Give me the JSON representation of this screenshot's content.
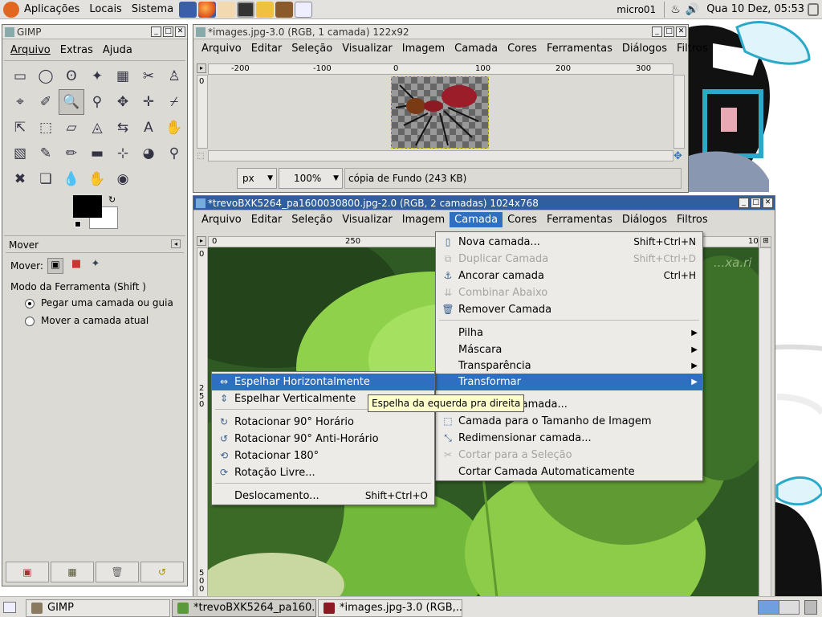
{
  "theme": {
    "accent": "#2f6fbf",
    "title_active": "#2f5f9f",
    "panel_bg": "#e4e2df",
    "window_bg": "#dcdad5",
    "leaf_green": "#7fbf3f"
  },
  "top_panel": {
    "menus": [
      "Aplicações",
      "Locais",
      "Sistema"
    ],
    "launchers": [
      "network-icon",
      "firefox-icon",
      "mascot-icon",
      "terminal-icon",
      "keys-icon",
      "tools-icon",
      "editor-icon"
    ],
    "user": "micro01",
    "datetime": "Qua 10 Dez, 05:53"
  },
  "toolbox": {
    "title": "GIMP",
    "menu": [
      "Arquivo",
      "Extras",
      "Ajuda"
    ],
    "tools": [
      "▭",
      "◯",
      "ʘ",
      "✦",
      "▦",
      "✂",
      "♙",
      "⌖",
      "✐",
      "🔍",
      "⚲",
      "✥",
      "✛",
      "⌿",
      "⇱",
      "⬚",
      "▱",
      "◬",
      "⇆",
      "A",
      "✋",
      "▧",
      "✎",
      "✏",
      "▬",
      "⊹",
      "◕",
      "⚲",
      "✖",
      "❏",
      "💧",
      "✋",
      "◉"
    ],
    "selected_tool_index": 9,
    "tool_options": {
      "title": "Mover",
      "mover_label": "Mover:",
      "mode_label": "Modo da Ferramenta (Shift )",
      "options": [
        "Pegar uma camada ou guia",
        "Mover a camada atual"
      ],
      "selected_option": 0
    },
    "bottom_buttons": [
      "save-icon",
      "restore-icon",
      "delete-icon",
      "reset-icon"
    ]
  },
  "window1": {
    "title": "*images.jpg-3.0 (RGB, 1 camada) 122x92",
    "menu": [
      "Arquivo",
      "Editar",
      "Seleção",
      "Visualizar",
      "Imagem",
      "Camada",
      "Cores",
      "Ferramentas",
      "Diálogos",
      "Filtros"
    ],
    "ruler_labels": [
      "-200",
      "-100",
      "0",
      "100",
      "200",
      "300"
    ],
    "vruler": "0",
    "unit": "px",
    "zoom": "100%",
    "status": "cópia de Fundo (243 KB)"
  },
  "window2": {
    "title": "*trevoBXK5264_pa1600030800.jpg-2.0 (RGB, 2 camadas) 1024x768",
    "menu": [
      "Arquivo",
      "Editar",
      "Seleção",
      "Visualizar",
      "Imagem",
      "Camada",
      "Cores",
      "Ferramentas",
      "Diálogos",
      "Filtros"
    ],
    "open_menu_index": 5,
    "ruler_labels": [
      "0",
      "250",
      "10"
    ],
    "vruler_labels": [
      "0",
      "2 5 0",
      "5 0 0"
    ],
    "watermark": "...xa.ri"
  },
  "camada_menu": {
    "items": [
      {
        "label": "Nova camada...",
        "shortcut": "Shift+Ctrl+N",
        "icon": "new-layer-icon",
        "glyph": "▯",
        "disabled": false
      },
      {
        "label": "Duplicar Camada",
        "shortcut": "Shift+Ctrl+D",
        "icon": "duplicate-layer-icon",
        "glyph": "⧉",
        "disabled": true
      },
      {
        "label": "Ancorar camada",
        "shortcut": "Ctrl+H",
        "icon": "anchor-icon",
        "glyph": "⚓",
        "disabled": false
      },
      {
        "label": "Combinar Abaixo",
        "shortcut": "",
        "icon": "merge-down-icon",
        "glyph": "⇊",
        "disabled": true
      },
      {
        "label": "Remover Camada",
        "shortcut": "",
        "icon": "trash-icon",
        "glyph": "🗑",
        "disabled": false
      },
      {
        "label": "Pilha",
        "submenu": true
      },
      {
        "label": "Máscara",
        "submenu": true
      },
      {
        "label": "Transparência",
        "submenu": true
      },
      {
        "label": "Transformar",
        "submenu": true,
        "highlighted": true
      },
      {
        "label": "Limites da camada...",
        "icon": "layer-boundary-icon",
        "glyph": "▢",
        "disabled": false,
        "prefix_hidden": "Limites da camada..."
      },
      {
        "label": "Camada para o Tamanho de Imagem",
        "icon": "layer-to-image-icon",
        "glyph": "⬚",
        "disabled": false
      },
      {
        "label": "Redimensionar camada...",
        "icon": "scale-layer-icon",
        "glyph": "⤡",
        "disabled": false
      },
      {
        "label": "Cortar para a Seleção",
        "icon": "crop-icon",
        "glyph": "✂",
        "disabled": true
      },
      {
        "label": "Cortar Camada Automaticamente",
        "disabled": false
      }
    ]
  },
  "transform_submenu": {
    "items": [
      {
        "label": "Espelhar Horizontalmente",
        "icon": "flip-horizontal-icon",
        "glyph": "⇔",
        "highlighted": true
      },
      {
        "label": "Espelhar Verticalmente",
        "icon": "flip-vertical-icon",
        "glyph": "⇕"
      },
      {
        "label": "Rotacionar 90° Horário",
        "icon": "rotate-cw-icon",
        "glyph": "↻"
      },
      {
        "label": "Rotacionar 90° Anti-Horário",
        "icon": "rotate-ccw-icon",
        "glyph": "↺"
      },
      {
        "label": "Rotacionar 180°",
        "icon": "rotate-180-icon",
        "glyph": "⟲"
      },
      {
        "label": "Rotação Livre...",
        "icon": "free-rotate-icon",
        "glyph": "⟳"
      },
      {
        "label": "Deslocamento...",
        "shortcut": "Shift+Ctrl+O"
      }
    ]
  },
  "tooltip": "Espelha da equerda pra direita",
  "taskbar": {
    "buttons": [
      "GIMP",
      "*trevoBXK5264_pa160...",
      "*images.jpg-3.0 (RGB,..."
    ]
  }
}
